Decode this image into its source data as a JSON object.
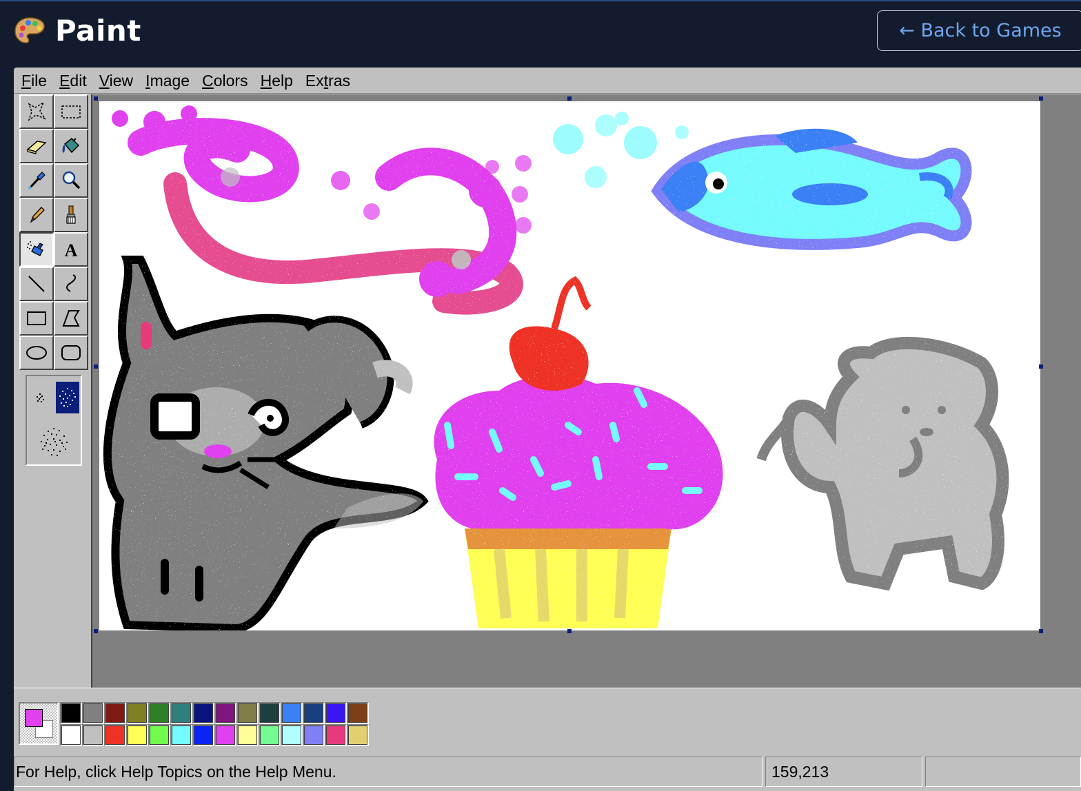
{
  "app": {
    "title": "Paint",
    "icon": "palette-icon",
    "back_label": "← Back to Games"
  },
  "menu": {
    "items": [
      {
        "pre": "",
        "ul": "F",
        "post": "ile"
      },
      {
        "pre": "",
        "ul": "E",
        "post": "dit"
      },
      {
        "pre": "",
        "ul": "V",
        "post": "iew"
      },
      {
        "pre": "",
        "ul": "I",
        "post": "mage"
      },
      {
        "pre": "",
        "ul": "C",
        "post": "olors"
      },
      {
        "pre": "",
        "ul": "H",
        "post": "elp"
      },
      {
        "pre": "Ex",
        "ul": "t",
        "post": "ras"
      }
    ]
  },
  "tools": [
    "free-form-select-icon",
    "select-icon",
    "eraser-icon",
    "fill-icon",
    "pick-color-icon",
    "magnifier-icon",
    "pencil-icon",
    "brush-icon",
    "airbrush-icon",
    "text-icon",
    "line-icon",
    "curve-icon",
    "rectangle-icon",
    "polygon-icon",
    "ellipse-icon",
    "rounded-rectangle-icon"
  ],
  "active_tool": "airbrush-icon",
  "airbrush_sizes": [
    "small",
    "medium",
    "large"
  ],
  "airbrush_selected": "medium",
  "colors": {
    "foreground": "#e040ee",
    "background": "#ffffff",
    "palette_top": [
      "#000000",
      "#808080",
      "#7f1a14",
      "#7f7f24",
      "#2e7f26",
      "#307f7f",
      "#0b137f",
      "#7f157f",
      "#7f7f47",
      "#1e3f3f",
      "#3b80f5",
      "#1a3f7e",
      "#3a16f5",
      "#7f3f16"
    ],
    "palette_bottom": [
      "#ffffff",
      "#c0c0c0",
      "#ee3325",
      "#fffe54",
      "#73fb4c",
      "#74fbfd",
      "#0a24f5",
      "#e040ee",
      "#fffe99",
      "#75fb92",
      "#b2fefe",
      "#7f7ff6",
      "#e73a7c",
      "#e0d070"
    ]
  },
  "status": {
    "help": "For Help, click Help Topics on the Help Menu.",
    "coords": "159,213",
    "extra": ""
  }
}
